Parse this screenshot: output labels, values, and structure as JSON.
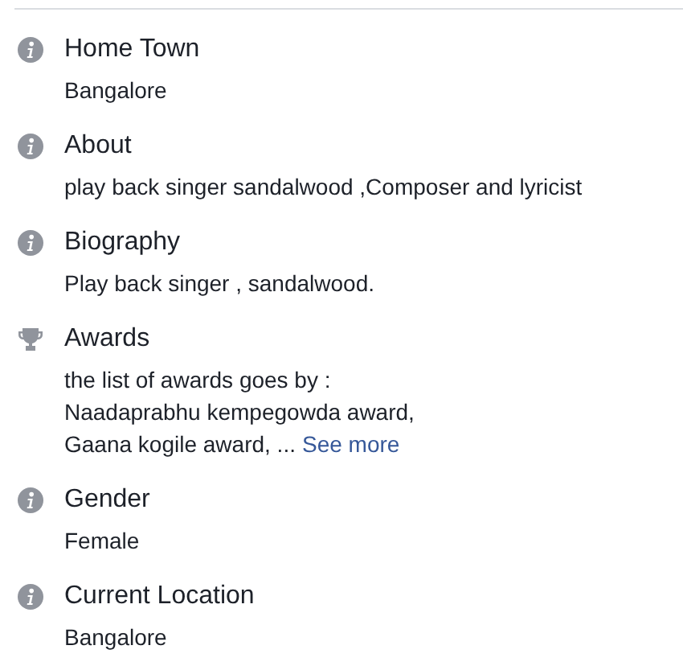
{
  "fields": [
    {
      "kind": "info",
      "label": "Home Town",
      "lines": [
        "Bangalore"
      ]
    },
    {
      "kind": "info",
      "label": "About",
      "lines": [
        "play back singer sandalwood ,Composer and lyricist"
      ]
    },
    {
      "kind": "info",
      "label": "Biography",
      "lines": [
        "Play back singer , sandalwood."
      ]
    },
    {
      "kind": "trophy",
      "label": "Awards",
      "lines": [
        "the list of awards goes by :",
        "Naadaprabhu kempegowda award,",
        "Gaana kogile award, ..."
      ],
      "link": "See more"
    },
    {
      "kind": "info",
      "label": "Gender",
      "lines": [
        "Female"
      ]
    },
    {
      "kind": "info",
      "label": "Current Location",
      "lines": [
        "Bangalore"
      ]
    }
  ]
}
